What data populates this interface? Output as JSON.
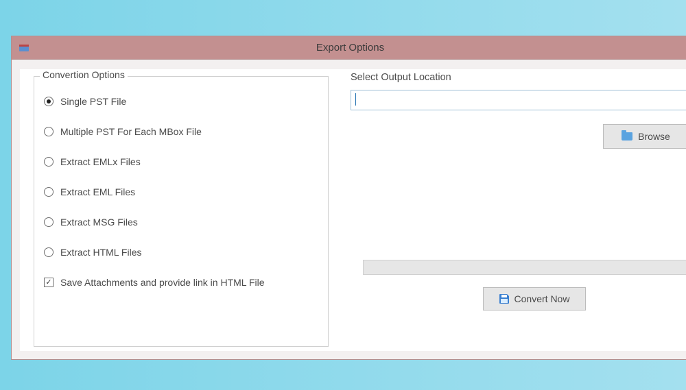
{
  "window": {
    "title": "Export Options"
  },
  "conversion": {
    "group_label": "Convertion Options",
    "options": [
      {
        "label": "Single PST File",
        "selected": true
      },
      {
        "label": "Multiple PST For Each MBox File",
        "selected": false
      },
      {
        "label": "Extract EMLx Files",
        "selected": false
      },
      {
        "label": "Extract EML Files",
        "selected": false
      },
      {
        "label": "Extract MSG Files",
        "selected": false
      },
      {
        "label": "Extract HTML Files",
        "selected": false
      }
    ],
    "save_attachments": {
      "label": "Save Attachments and provide link in HTML File",
      "checked": true
    }
  },
  "output": {
    "label": "Select Output Location",
    "value": "",
    "browse_label": "Browse"
  },
  "actions": {
    "convert_label": "Convert Now"
  },
  "progress": {
    "percent": 0
  }
}
